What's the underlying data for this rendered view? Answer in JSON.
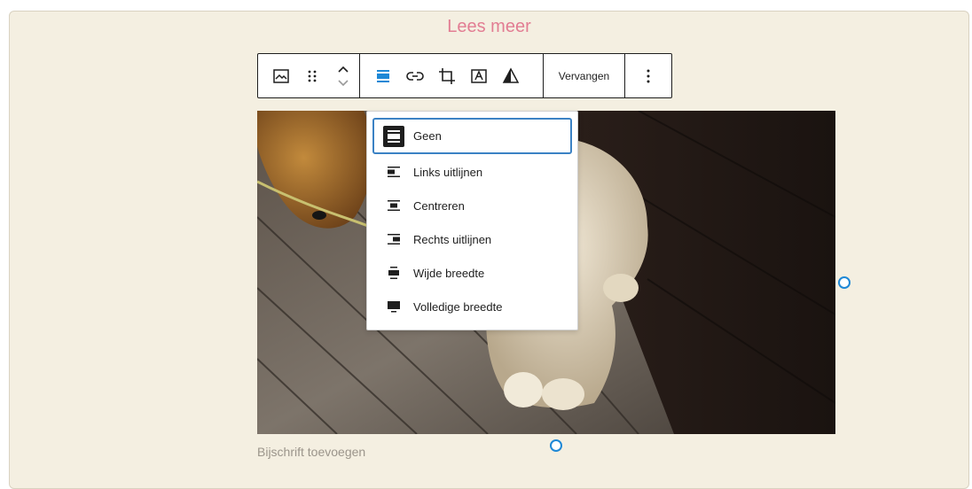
{
  "header": {
    "link_text": "Lees meer"
  },
  "toolbar": {
    "icons": [
      "image-icon",
      "drag-handle-icon",
      "move-updown-icon",
      "align-icon",
      "link-icon",
      "crop-icon",
      "text-overlay-icon",
      "duotone-icon",
      "more-icon"
    ],
    "replace_label": "Vervangen",
    "accent": "#1e88d6"
  },
  "align_menu": {
    "items": [
      {
        "label": "Geen",
        "icon": "align-none-icon",
        "selected": true
      },
      {
        "label": "Links uitlijnen",
        "icon": "align-left-icon",
        "selected": false
      },
      {
        "label": "Centreren",
        "icon": "align-center-icon",
        "selected": false
      },
      {
        "label": "Rechts uitlijnen",
        "icon": "align-right-icon",
        "selected": false
      },
      {
        "label": "Wijde breedte",
        "icon": "align-wide-icon",
        "selected": false
      },
      {
        "label": "Volledige breedte",
        "icon": "align-full-icon",
        "selected": false
      }
    ]
  },
  "image": {
    "caption_placeholder": "Bijschrift toevoegen"
  },
  "colors": {
    "background": "#f4efe1",
    "link": "#e27d93",
    "selection": "#3b82c4"
  }
}
